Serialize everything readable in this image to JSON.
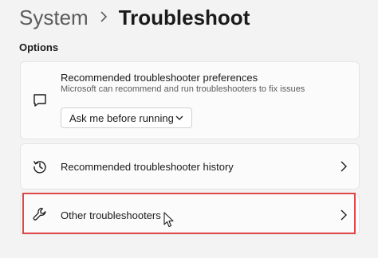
{
  "breadcrumb": {
    "parent": "System",
    "separator": ">",
    "current": "Troubleshoot"
  },
  "section": {
    "label": "Options"
  },
  "cards": {
    "preferences": {
      "icon": "chat-bubble-icon",
      "title": "Recommended troubleshooter preferences",
      "description": "Microsoft can recommend and run troubleshooters to fix issues",
      "dropdown_value": "Ask me before running"
    },
    "history": {
      "icon": "history-icon",
      "title": "Recommended troubleshooter history"
    },
    "other": {
      "icon": "wrench-icon",
      "title": "Other troubleshooters"
    }
  },
  "colors": {
    "background": "#f3f3f3",
    "card": "#fbfbfb",
    "highlight": "#e04848"
  }
}
